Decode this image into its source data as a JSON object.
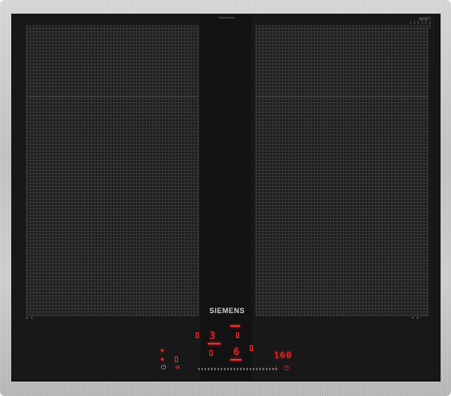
{
  "brand": "SIEMENS",
  "corner_label": [
    "NOSQFT",
    "I I I I I I I"
  ],
  "display": {
    "front_left_level": "3",
    "front_right_level": "6",
    "timer_value": "160"
  },
  "zone_indicators": {
    "left": "▭ ⊥",
    "right": "▭ ⊥"
  },
  "icons": {
    "power": "⏻",
    "timer": "◷",
    "lock": "⊥",
    "wifi": "≋"
  },
  "colors": {
    "glass": "#181818",
    "frame": "#c6c8ca",
    "indicator_red": "#ff2a2a"
  }
}
